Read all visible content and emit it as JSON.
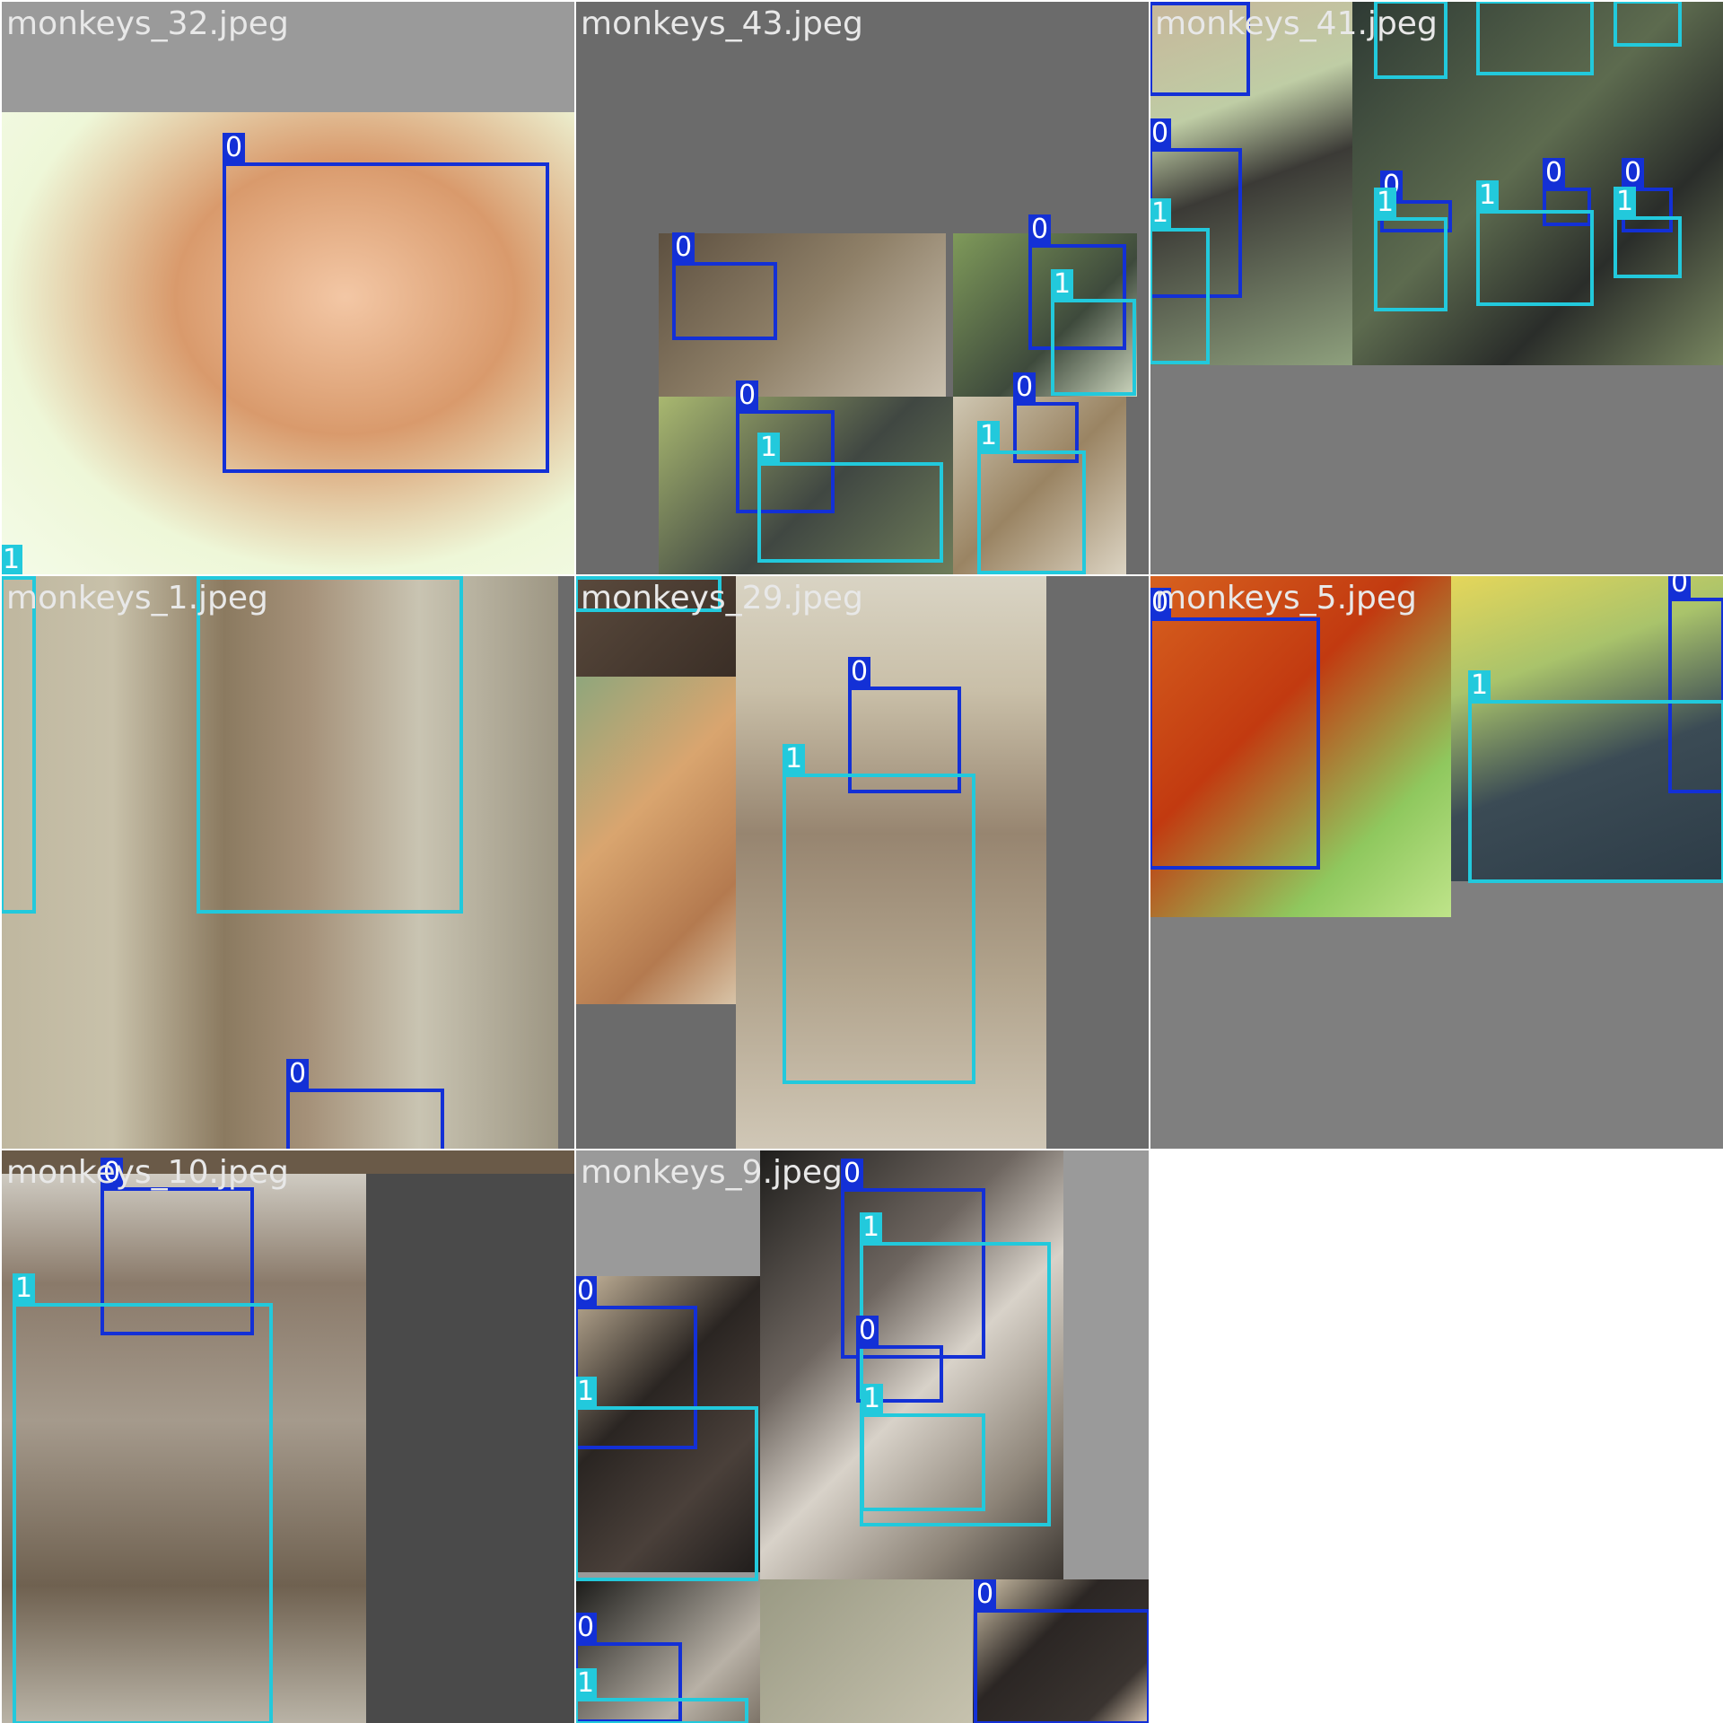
{
  "labels": {
    "cls0": "0",
    "cls1": "1"
  },
  "colors": {
    "cls0": "#1330d6",
    "cls1": "#22c9dc",
    "background": "#7f7f7f",
    "title": "#e8e8e8"
  },
  "tiles": [
    {
      "title": "monkeys_32.jpeg"
    },
    {
      "title": "monkeys_43.jpeg"
    },
    {
      "title": "monkeys_41.jpeg"
    },
    {
      "title": "monkeys_1.jpeg"
    },
    {
      "title": "monkeys_29.jpeg"
    },
    {
      "title": "monkeys_5.jpeg"
    },
    {
      "title": "monkeys_10.jpeg"
    },
    {
      "title": "monkeys_9.jpeg"
    }
  ]
}
